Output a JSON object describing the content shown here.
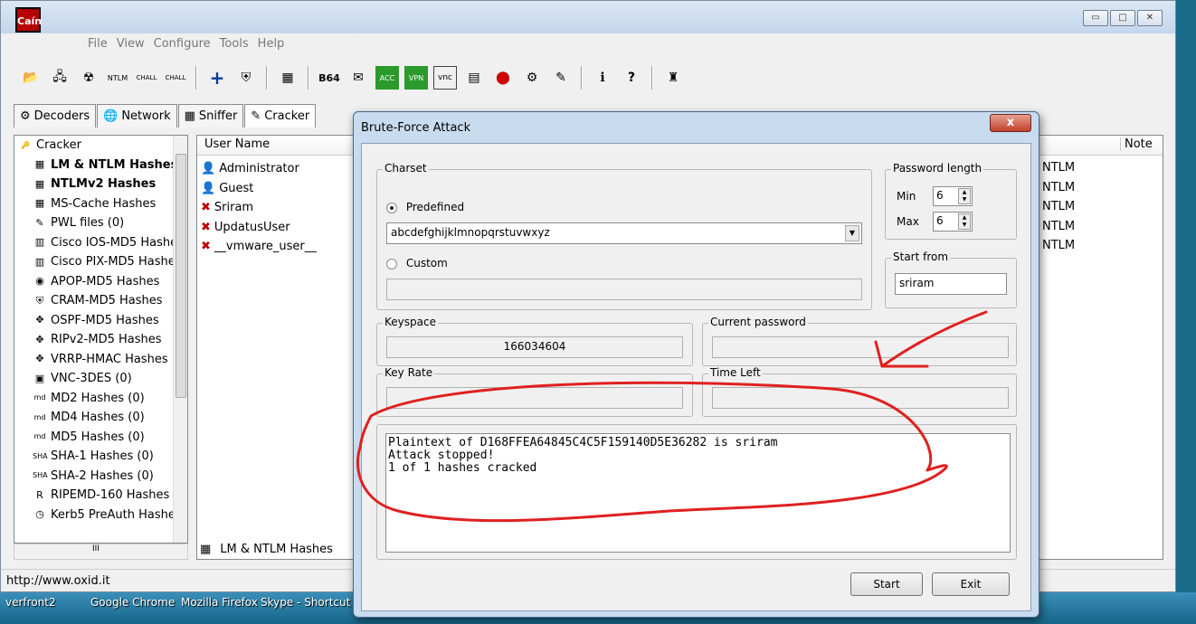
{
  "app": {
    "logo_text": "Caín"
  },
  "window_controls": {
    "minimize": "▭",
    "maximize": "□",
    "close": "✕"
  },
  "menu": [
    "File",
    "View",
    "Configure",
    "Tools",
    "Help"
  ],
  "toolbar": {
    "icons": [
      "open-folder-icon",
      "add-network-icon",
      "radiation-icon",
      "ntlm-auth-icon",
      "chall-spoof-reset-icon",
      "chall-spoof-ntlm-icon",
      "plus-icon",
      "shield-icon",
      "hash-icon",
      "base64-icon",
      "certificate-icon",
      "access-db-icon",
      "vpn-icon",
      "vnc-icon",
      "calculator-icon",
      "stop-icon",
      "gear-icon",
      "password-icon",
      "info-icon",
      "help-icon",
      "tower-icon"
    ]
  },
  "tabs": [
    {
      "label": "Decoders",
      "icon": "decoders-icon"
    },
    {
      "label": "Network",
      "icon": "network-icon"
    },
    {
      "label": "Sniffer",
      "icon": "sniffer-icon"
    },
    {
      "label": "Cracker",
      "icon": "cracker-icon"
    }
  ],
  "sidebar": {
    "items": [
      {
        "label": "Cracker",
        "icon": "key-icon",
        "bold": false
      },
      {
        "label": "LM & NTLM Hashes",
        "icon": "hash-icon",
        "bold": true
      },
      {
        "label": "NTLMv2 Hashes",
        "icon": "hash-icon",
        "bold": true
      },
      {
        "label": "MS-Cache Hashes",
        "icon": "hash-icon",
        "bold": false
      },
      {
        "label": "PWL files (0)",
        "icon": "pwl-icon",
        "bold": false
      },
      {
        "label": "Cisco IOS-MD5 Hashes",
        "icon": "cisco-icon",
        "bold": false
      },
      {
        "label": "Cisco PIX-MD5 Hashes",
        "icon": "cisco-icon",
        "bold": false
      },
      {
        "label": "APOP-MD5 Hashes",
        "icon": "apop-icon",
        "bold": false
      },
      {
        "label": "CRAM-MD5 Hashes",
        "icon": "cram-icon",
        "bold": false
      },
      {
        "label": "OSPF-MD5 Hashes",
        "icon": "ospf-icon",
        "bold": false
      },
      {
        "label": "RIPv2-MD5 Hashes",
        "icon": "rip-icon",
        "bold": false
      },
      {
        "label": "VRRP-HMAC Hashes",
        "icon": "vrrp-icon",
        "bold": false
      },
      {
        "label": "VNC-3DES (0)",
        "icon": "vnc-icon",
        "bold": false
      },
      {
        "label": "MD2 Hashes (0)",
        "icon": "md2-icon",
        "bold": false
      },
      {
        "label": "MD4 Hashes (0)",
        "icon": "md4-icon",
        "bold": false
      },
      {
        "label": "MD5 Hashes (0)",
        "icon": "md5-icon",
        "bold": false
      },
      {
        "label": "SHA-1 Hashes (0)",
        "icon": "sha1-icon",
        "bold": false
      },
      {
        "label": "SHA-2 Hashes (0)",
        "icon": "sha2-icon",
        "bold": false
      },
      {
        "label": "RIPEMD-160 Hashes",
        "icon": "ripemd-icon",
        "bold": false
      },
      {
        "label": "Kerb5 PreAuth Hashes",
        "icon": "clock-icon",
        "bold": false
      }
    ],
    "hscroll_label": "III"
  },
  "list": {
    "columns": {
      "user_name": "User Name",
      "note": "Note"
    },
    "rows": [
      {
        "name": "Administrator",
        "icon": "user-key-icon",
        "type": "NTLM"
      },
      {
        "name": "Guest",
        "icon": "user-key-icon",
        "type": "NTLM"
      },
      {
        "name": "Sriram",
        "icon": "red-x-icon",
        "type": "NTLM"
      },
      {
        "name": "UpdatusUser",
        "icon": "red-x-icon",
        "type": "NTLM"
      },
      {
        "name": "__vmware_user__",
        "icon": "red-x-icon",
        "type": "NTLM"
      }
    ],
    "bottom_tab": "LM & NTLM Hashes"
  },
  "status": {
    "url": "http://www.oxid.it"
  },
  "desktop": {
    "items": [
      "verfront2",
      "Google Chrome",
      "Mozilla Firefox",
      "Skype - Shortcut"
    ]
  },
  "dialog": {
    "title": "Brute-Force Attack",
    "close": "x",
    "charset": {
      "legend": "Charset",
      "predefined_label": "Predefined",
      "predefined_value": "abcdefghijklmnopqrstuvwxyz",
      "custom_label": "Custom",
      "custom_value": ""
    },
    "password_length": {
      "legend": "Password length",
      "min_label": "Min",
      "min": "6",
      "max_label": "Max",
      "max": "6"
    },
    "start_from": {
      "legend": "Start from",
      "value": "sriram"
    },
    "keyspace": {
      "legend": "Keyspace",
      "value": "166034604"
    },
    "current_password": {
      "legend": "Current password",
      "value": ""
    },
    "key_rate": {
      "legend": "Key Rate",
      "value": ""
    },
    "time_left": {
      "legend": "Time Left",
      "value": ""
    },
    "log": "Plaintext of D168FFEA64845C4C5F159140D5E36282 is sriram\nAttack stopped!\n1 of 1 hashes cracked",
    "buttons": {
      "start": "Start",
      "exit": "Exit"
    }
  }
}
